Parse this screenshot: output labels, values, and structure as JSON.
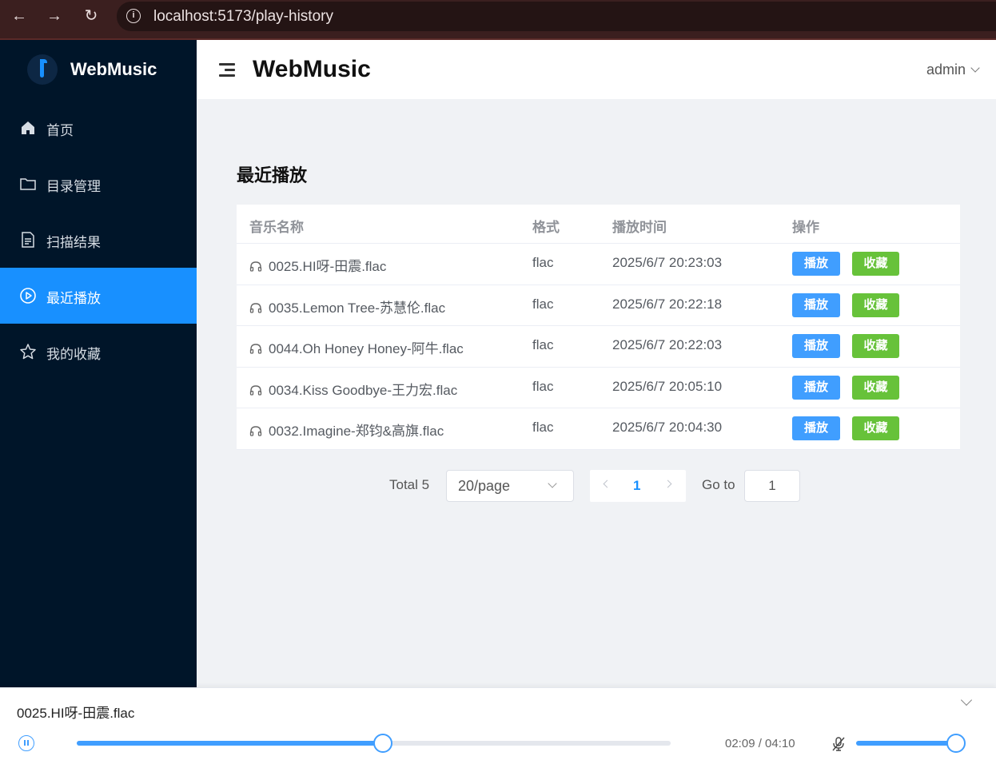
{
  "browser": {
    "url": "localhost:5173/play-history"
  },
  "sidebar": {
    "brand": "WebMusic",
    "items": [
      {
        "label": "首页",
        "icon": "home-icon",
        "active": false
      },
      {
        "label": "目录管理",
        "icon": "folder-icon",
        "active": false
      },
      {
        "label": "扫描结果",
        "icon": "document-icon",
        "active": false
      },
      {
        "label": "最近播放",
        "icon": "play-circle-icon",
        "active": true
      },
      {
        "label": "我的收藏",
        "icon": "star-icon",
        "active": false
      }
    ]
  },
  "header": {
    "title": "WebMusic",
    "user": "admin"
  },
  "main": {
    "title": "最近播放",
    "columns": [
      "音乐名称",
      "格式",
      "播放时间",
      "操作"
    ],
    "rows": [
      {
        "name": "0025.HI呀-田震.flac",
        "format": "flac",
        "time": "2025/6/7 20:23:03"
      },
      {
        "name": "0035.Lemon Tree-苏慧伦.flac",
        "format": "flac",
        "time": "2025/6/7 20:22:18"
      },
      {
        "name": "0044.Oh Honey Honey-阿牛.flac",
        "format": "flac",
        "time": "2025/6/7 20:22:03"
      },
      {
        "name": "0034.Kiss Goodbye-王力宏.flac",
        "format": "flac",
        "time": "2025/6/7 20:05:10"
      },
      {
        "name": "0032.Imagine-郑钧&高旗.flac",
        "format": "flac",
        "time": "2025/6/7 20:04:30"
      }
    ],
    "actions": {
      "play": "播放",
      "favorite": "收藏"
    },
    "colors": {
      "primary": "#409eff",
      "success": "#67c23a",
      "sidebar_bg": "#001529",
      "active": "#1890ff"
    }
  },
  "pagination": {
    "total_label": "Total 5",
    "page_size": "20/page",
    "current_page": "1",
    "goto_label": "Go to",
    "goto_value": "1"
  },
  "player": {
    "now_playing": "0025.HI呀-田震.flac",
    "time": "02:09 / 04:10",
    "progress": 0.516,
    "volume": 1.0
  }
}
